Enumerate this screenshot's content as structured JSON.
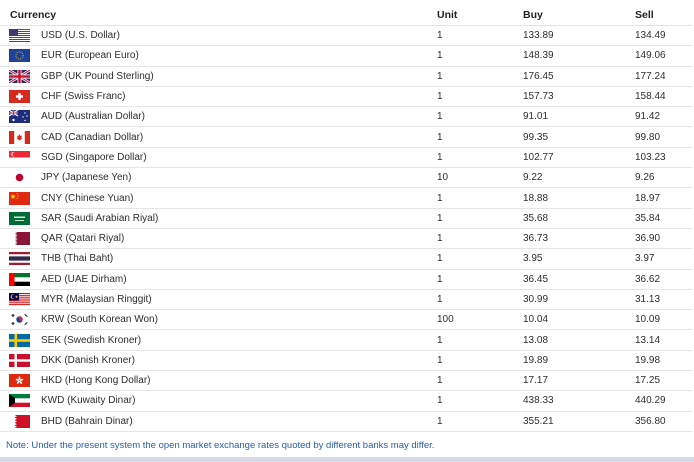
{
  "headers": {
    "currency": "Currency",
    "unit": "Unit",
    "buy": "Buy",
    "sell": "Sell"
  },
  "rows": [
    {
      "flag": "us-flag-icon",
      "currency": "USD (U.S. Dollar)",
      "unit": "1",
      "buy": "133.89",
      "sell": "134.49"
    },
    {
      "flag": "eu-flag-icon",
      "currency": "EUR (European Euro)",
      "unit": "1",
      "buy": "148.39",
      "sell": "149.06"
    },
    {
      "flag": "gb-flag-icon",
      "currency": "GBP (UK Pound Sterling)",
      "unit": "1",
      "buy": "176.45",
      "sell": "177.24"
    },
    {
      "flag": "ch-flag-icon",
      "currency": "CHF (Swiss Franc)",
      "unit": "1",
      "buy": "157.73",
      "sell": "158.44"
    },
    {
      "flag": "au-flag-icon",
      "currency": "AUD (Australian Dollar)",
      "unit": "1",
      "buy": "91.01",
      "sell": "91.42"
    },
    {
      "flag": "ca-flag-icon",
      "currency": "CAD (Canadian Dollar)",
      "unit": "1",
      "buy": "99.35",
      "sell": "99.80"
    },
    {
      "flag": "sg-flag-icon",
      "currency": "SGD (Singapore Dollar)",
      "unit": "1",
      "buy": "102.77",
      "sell": "103.23"
    },
    {
      "flag": "jp-flag-icon",
      "currency": "JPY (Japanese Yen)",
      "unit": "10",
      "buy": "9.22",
      "sell": "9.26"
    },
    {
      "flag": "cn-flag-icon",
      "currency": "CNY (Chinese Yuan)",
      "unit": "1",
      "buy": "18.88",
      "sell": "18.97"
    },
    {
      "flag": "sa-flag-icon",
      "currency": "SAR (Saudi Arabian Riyal)",
      "unit": "1",
      "buy": "35.68",
      "sell": "35.84"
    },
    {
      "flag": "qa-flag-icon",
      "currency": "QAR (Qatari Riyal)",
      "unit": "1",
      "buy": "36.73",
      "sell": "36.90"
    },
    {
      "flag": "th-flag-icon",
      "currency": "THB (Thai Baht)",
      "unit": "1",
      "buy": "3.95",
      "sell": "3.97"
    },
    {
      "flag": "ae-flag-icon",
      "currency": "AED (UAE Dirham)",
      "unit": "1",
      "buy": "36.45",
      "sell": "36.62"
    },
    {
      "flag": "my-flag-icon",
      "currency": "MYR (Malaysian Ringgit)",
      "unit": "1",
      "buy": "30.99",
      "sell": "31.13"
    },
    {
      "flag": "kr-flag-icon",
      "currency": "KRW (South Korean Won)",
      "unit": "100",
      "buy": "10.04",
      "sell": "10.09"
    },
    {
      "flag": "se-flag-icon",
      "currency": "SEK (Swedish Kroner)",
      "unit": "1",
      "buy": "13.08",
      "sell": "13.14"
    },
    {
      "flag": "dk-flag-icon",
      "currency": "DKK (Danish Kroner)",
      "unit": "1",
      "buy": "19.89",
      "sell": "19.98"
    },
    {
      "flag": "hk-flag-icon",
      "currency": "HKD (Hong Kong Dollar)",
      "unit": "1",
      "buy": "17.17",
      "sell": "17.25"
    },
    {
      "flag": "kw-flag-icon",
      "currency": "KWD (Kuwaity Dinar)",
      "unit": "1",
      "buy": "438.33",
      "sell": "440.29"
    },
    {
      "flag": "bh-flag-icon",
      "currency": "BHD (Bahrain Dinar)",
      "unit": "1",
      "buy": "355.21",
      "sell": "356.80"
    }
  ],
  "note": "Note: Under the present system the open market exchange rates quoted by different banks may differ.",
  "colors": {
    "note": "#2a5db0",
    "divider": "#e5e5e5"
  }
}
